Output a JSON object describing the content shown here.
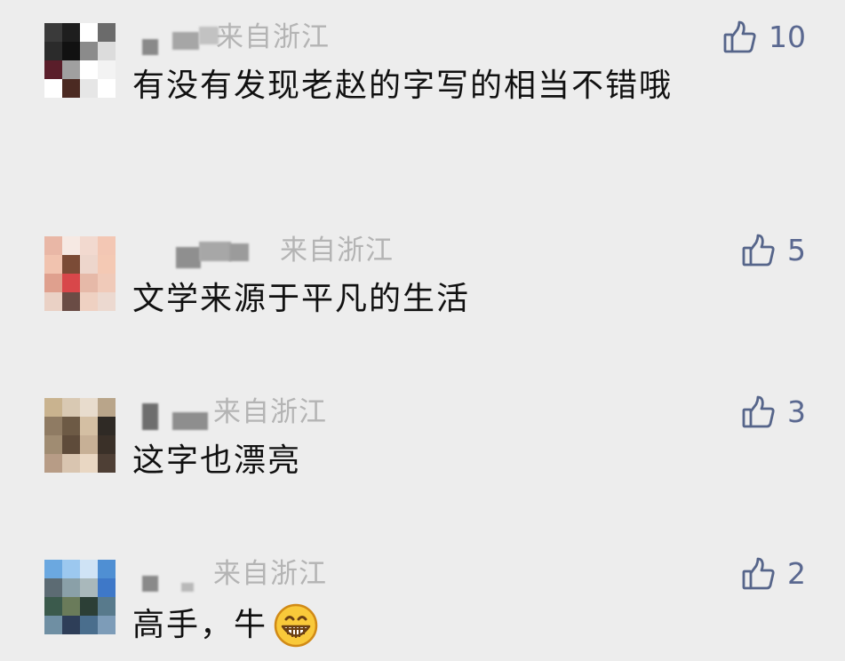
{
  "comments": [
    {
      "location": "来自浙江",
      "text": "有没有发现老赵的字写的相当不错哦",
      "likes": "10",
      "avatar_palette": [
        "#3a3a3a",
        "#1e1e1e",
        "#ffffff",
        "#6b6b6b",
        "#2b2b2b",
        "#111111",
        "#8b8b8b",
        "#dcdcdc",
        "#5a1e2a",
        "#a0a0a0",
        "#ffffff",
        "#f3f3f3",
        "#ffffff",
        "#4b2a22",
        "#e6e6e6",
        "#ffffff"
      ],
      "icon": "thumbs-up-icon"
    },
    {
      "location": "来自浙江",
      "text": "文学来源于平凡的生活",
      "likes": "5",
      "avatar_palette": [
        "#e9b7a6",
        "#f6e9e3",
        "#f2d9cf",
        "#f3c7b4",
        "#f1c3af",
        "#7b4b36",
        "#edd6cc",
        "#f4c9b4",
        "#dfa08e",
        "#d8474a",
        "#e6b9a8",
        "#f0cab9",
        "#ead1c5",
        "#6a4c45",
        "#efd1c2",
        "#ecd9d0"
      ],
      "icon": "thumbs-up-icon"
    },
    {
      "location": "来自浙江",
      "text": "这字也漂亮",
      "likes": "3",
      "avatar_palette": [
        "#c9b38f",
        "#d9c9b3",
        "#e8dccd",
        "#b9a58a",
        "#8f7b63",
        "#6d5a45",
        "#d4bfa3",
        "#2f2a25",
        "#a08c72",
        "#5e4b3a",
        "#c7b096",
        "#3a3028",
        "#b79c86",
        "#d9c5b0",
        "#e9d7c3",
        "#4e3f35"
      ],
      "icon": "thumbs-up-icon"
    },
    {
      "location": "来自浙江",
      "text": "高手，牛",
      "likes": "2",
      "avatar_palette": [
        "#6ba8e0",
        "#9cc8ef",
        "#cfe3f5",
        "#4f8fd3",
        "#5c6b73",
        "#8aa0a8",
        "#a9b8bb",
        "#3e78c8",
        "#3b5a4c",
        "#6a7b5a",
        "#2c3f36",
        "#587a8c",
        "#6f8fa3",
        "#2e3e58",
        "#4a6e8d",
        "#7d9cb8"
      ],
      "icon": "thumbs-up-icon",
      "emoji": "grinning-face-emoji"
    }
  ]
}
